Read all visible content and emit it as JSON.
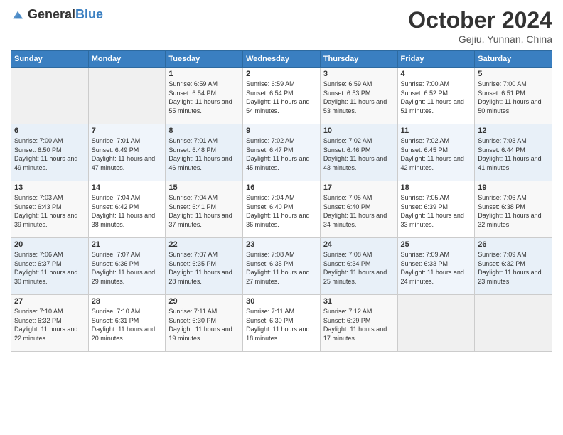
{
  "header": {
    "logo_general": "General",
    "logo_blue": "Blue",
    "month": "October 2024",
    "location": "Gejiu, Yunnan, China"
  },
  "columns": [
    "Sunday",
    "Monday",
    "Tuesday",
    "Wednesday",
    "Thursday",
    "Friday",
    "Saturday"
  ],
  "weeks": [
    [
      {
        "day": "",
        "sunrise": "",
        "sunset": "",
        "daylight": ""
      },
      {
        "day": "",
        "sunrise": "",
        "sunset": "",
        "daylight": ""
      },
      {
        "day": "1",
        "sunrise": "Sunrise: 6:59 AM",
        "sunset": "Sunset: 6:54 PM",
        "daylight": "Daylight: 11 hours and 55 minutes."
      },
      {
        "day": "2",
        "sunrise": "Sunrise: 6:59 AM",
        "sunset": "Sunset: 6:54 PM",
        "daylight": "Daylight: 11 hours and 54 minutes."
      },
      {
        "day": "3",
        "sunrise": "Sunrise: 6:59 AM",
        "sunset": "Sunset: 6:53 PM",
        "daylight": "Daylight: 11 hours and 53 minutes."
      },
      {
        "day": "4",
        "sunrise": "Sunrise: 7:00 AM",
        "sunset": "Sunset: 6:52 PM",
        "daylight": "Daylight: 11 hours and 51 minutes."
      },
      {
        "day": "5",
        "sunrise": "Sunrise: 7:00 AM",
        "sunset": "Sunset: 6:51 PM",
        "daylight": "Daylight: 11 hours and 50 minutes."
      }
    ],
    [
      {
        "day": "6",
        "sunrise": "Sunrise: 7:00 AM",
        "sunset": "Sunset: 6:50 PM",
        "daylight": "Daylight: 11 hours and 49 minutes."
      },
      {
        "day": "7",
        "sunrise": "Sunrise: 7:01 AM",
        "sunset": "Sunset: 6:49 PM",
        "daylight": "Daylight: 11 hours and 47 minutes."
      },
      {
        "day": "8",
        "sunrise": "Sunrise: 7:01 AM",
        "sunset": "Sunset: 6:48 PM",
        "daylight": "Daylight: 11 hours and 46 minutes."
      },
      {
        "day": "9",
        "sunrise": "Sunrise: 7:02 AM",
        "sunset": "Sunset: 6:47 PM",
        "daylight": "Daylight: 11 hours and 45 minutes."
      },
      {
        "day": "10",
        "sunrise": "Sunrise: 7:02 AM",
        "sunset": "Sunset: 6:46 PM",
        "daylight": "Daylight: 11 hours and 43 minutes."
      },
      {
        "day": "11",
        "sunrise": "Sunrise: 7:02 AM",
        "sunset": "Sunset: 6:45 PM",
        "daylight": "Daylight: 11 hours and 42 minutes."
      },
      {
        "day": "12",
        "sunrise": "Sunrise: 7:03 AM",
        "sunset": "Sunset: 6:44 PM",
        "daylight": "Daylight: 11 hours and 41 minutes."
      }
    ],
    [
      {
        "day": "13",
        "sunrise": "Sunrise: 7:03 AM",
        "sunset": "Sunset: 6:43 PM",
        "daylight": "Daylight: 11 hours and 39 minutes."
      },
      {
        "day": "14",
        "sunrise": "Sunrise: 7:04 AM",
        "sunset": "Sunset: 6:42 PM",
        "daylight": "Daylight: 11 hours and 38 minutes."
      },
      {
        "day": "15",
        "sunrise": "Sunrise: 7:04 AM",
        "sunset": "Sunset: 6:41 PM",
        "daylight": "Daylight: 11 hours and 37 minutes."
      },
      {
        "day": "16",
        "sunrise": "Sunrise: 7:04 AM",
        "sunset": "Sunset: 6:40 PM",
        "daylight": "Daylight: 11 hours and 36 minutes."
      },
      {
        "day": "17",
        "sunrise": "Sunrise: 7:05 AM",
        "sunset": "Sunset: 6:40 PM",
        "daylight": "Daylight: 11 hours and 34 minutes."
      },
      {
        "day": "18",
        "sunrise": "Sunrise: 7:05 AM",
        "sunset": "Sunset: 6:39 PM",
        "daylight": "Daylight: 11 hours and 33 minutes."
      },
      {
        "day": "19",
        "sunrise": "Sunrise: 7:06 AM",
        "sunset": "Sunset: 6:38 PM",
        "daylight": "Daylight: 11 hours and 32 minutes."
      }
    ],
    [
      {
        "day": "20",
        "sunrise": "Sunrise: 7:06 AM",
        "sunset": "Sunset: 6:37 PM",
        "daylight": "Daylight: 11 hours and 30 minutes."
      },
      {
        "day": "21",
        "sunrise": "Sunrise: 7:07 AM",
        "sunset": "Sunset: 6:36 PM",
        "daylight": "Daylight: 11 hours and 29 minutes."
      },
      {
        "day": "22",
        "sunrise": "Sunrise: 7:07 AM",
        "sunset": "Sunset: 6:35 PM",
        "daylight": "Daylight: 11 hours and 28 minutes."
      },
      {
        "day": "23",
        "sunrise": "Sunrise: 7:08 AM",
        "sunset": "Sunset: 6:35 PM",
        "daylight": "Daylight: 11 hours and 27 minutes."
      },
      {
        "day": "24",
        "sunrise": "Sunrise: 7:08 AM",
        "sunset": "Sunset: 6:34 PM",
        "daylight": "Daylight: 11 hours and 25 minutes."
      },
      {
        "day": "25",
        "sunrise": "Sunrise: 7:09 AM",
        "sunset": "Sunset: 6:33 PM",
        "daylight": "Daylight: 11 hours and 24 minutes."
      },
      {
        "day": "26",
        "sunrise": "Sunrise: 7:09 AM",
        "sunset": "Sunset: 6:32 PM",
        "daylight": "Daylight: 11 hours and 23 minutes."
      }
    ],
    [
      {
        "day": "27",
        "sunrise": "Sunrise: 7:10 AM",
        "sunset": "Sunset: 6:32 PM",
        "daylight": "Daylight: 11 hours and 22 minutes."
      },
      {
        "day": "28",
        "sunrise": "Sunrise: 7:10 AM",
        "sunset": "Sunset: 6:31 PM",
        "daylight": "Daylight: 11 hours and 20 minutes."
      },
      {
        "day": "29",
        "sunrise": "Sunrise: 7:11 AM",
        "sunset": "Sunset: 6:30 PM",
        "daylight": "Daylight: 11 hours and 19 minutes."
      },
      {
        "day": "30",
        "sunrise": "Sunrise: 7:11 AM",
        "sunset": "Sunset: 6:30 PM",
        "daylight": "Daylight: 11 hours and 18 minutes."
      },
      {
        "day": "31",
        "sunrise": "Sunrise: 7:12 AM",
        "sunset": "Sunset: 6:29 PM",
        "daylight": "Daylight: 11 hours and 17 minutes."
      },
      {
        "day": "",
        "sunrise": "",
        "sunset": "",
        "daylight": ""
      },
      {
        "day": "",
        "sunrise": "",
        "sunset": "",
        "daylight": ""
      }
    ]
  ]
}
